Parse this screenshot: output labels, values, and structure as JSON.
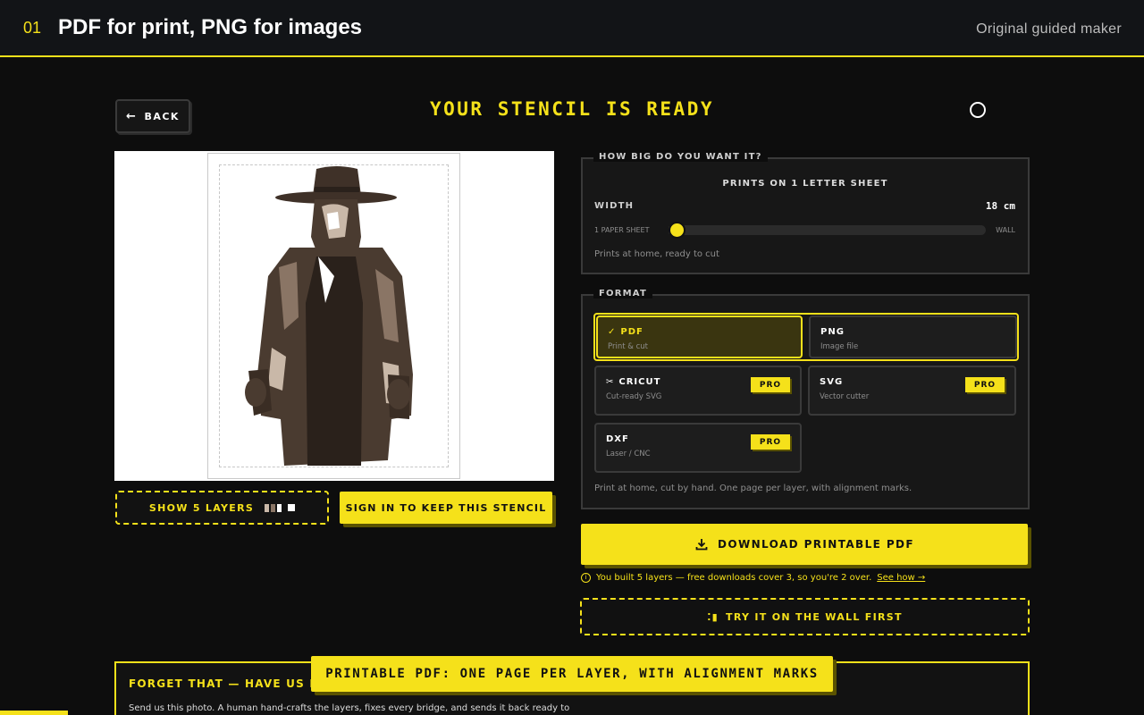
{
  "header": {
    "step": "01",
    "title": "PDF for print, PNG for images",
    "right_label": "Original guided maker"
  },
  "back": {
    "label": "BACK"
  },
  "page_title": "YOUR STENCIL IS READY",
  "preview": {
    "show_layers_label": "SHOW 5 LAYERS",
    "layer_swatches": [
      "#c9b8a8",
      "#8a7565",
      "#ffffff",
      "#4a3b30"
    ],
    "sign_in_label": "SIGN IN TO KEEP THIS STENCIL"
  },
  "size": {
    "legend": "HOW BIG DO YOU WANT IT?",
    "prints_on": "PRINTS ON 1 LETTER SHEET",
    "width_label": "WIDTH",
    "width_value": "18 cm",
    "slider_min": "1 PAPER SHEET",
    "slider_max": "WALL",
    "slider_fraction": 0.02,
    "note": "Prints at home, ready to cut"
  },
  "format": {
    "legend": "FORMAT",
    "pdf": {
      "title": "PDF",
      "sub": "Print & cut"
    },
    "png": {
      "title": "PNG",
      "sub": "Image file"
    },
    "cricut": {
      "title": "CRICUT",
      "sub": "Cut-ready SVG",
      "badge": "PRO"
    },
    "svg": {
      "title": "SVG",
      "sub": "Vector cutter",
      "badge": "PRO"
    },
    "dxf": {
      "title": "DXF",
      "sub": "Laser / CNC",
      "badge": "PRO"
    },
    "note": "Print at home, cut by hand. One page per layer, with alignment marks."
  },
  "download": {
    "label": "DOWNLOAD PRINTABLE PDF"
  },
  "info": {
    "text": "You built 5 layers — free downloads cover 3, so you're 2 over.",
    "link": "See how →"
  },
  "try_wall": {
    "label": "TRY IT ON THE WALL FIRST"
  },
  "bottom": {
    "title": "FORGET THAT — HAVE US MA",
    "text": "Send us this photo. A human hand-crafts the layers, fixes every bridge, and sends it back ready to"
  },
  "tooltip": {
    "text": "PRINTABLE PDF: ONE PAGE PER LAYER, WITH ALIGNMENT MARKS"
  },
  "colors": {
    "accent": "#f5e11a",
    "background": "#0d0d0d",
    "panel": "#171717"
  }
}
